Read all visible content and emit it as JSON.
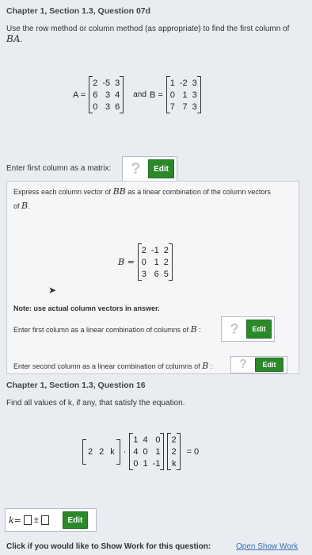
{
  "section1": {
    "title": "Chapter 1, Section 1.3, Question 07d",
    "instruction": "Use the row method or column method (as appropriate) to find the first column of",
    "target": "BA",
    "matrix_a_label": "A =",
    "matrix_a": [
      [
        "2",
        "-5",
        "3"
      ],
      [
        "6",
        "3",
        "4"
      ],
      [
        "0",
        "3",
        "6"
      ]
    ],
    "and_label": "and",
    "matrix_b_label": "B =",
    "matrix_b": [
      [
        "1",
        "-2",
        "3"
      ],
      [
        "0",
        "1",
        "3"
      ],
      [
        "7",
        "7",
        "3"
      ]
    ],
    "enter_label": "Enter first column as a matrix:",
    "placeholder": "?",
    "edit_label": "Edit"
  },
  "hint": {
    "text_a": "Express each column vector of",
    "var_a": "BB",
    "text_b": "as a linear combination of the column vectors",
    "text_c": "of",
    "var_b": "B",
    "matrix_label": "B =",
    "matrix": [
      [
        "2",
        "-1",
        "2"
      ],
      [
        "0",
        "1",
        "2"
      ],
      [
        "3",
        "6",
        "5"
      ]
    ],
    "note_bold": "Note:",
    "note_text": "use actual column vectors in answer.",
    "first_col_label": "Enter first column as a linear combination of columns of",
    "second_col_label": "Enter second column as a linear combination of columns of",
    "var_c": "B",
    "colon": ":",
    "placeholder": "?",
    "edit_label": "Edit"
  },
  "section2": {
    "title": "Chapter 1, Section 1.3, Question 16",
    "instruction": "Find all values of k, if any, that satisfy the equation.",
    "row_vec": [
      "2",
      "2",
      "k"
    ],
    "dot": "·",
    "matrix": [
      [
        "1",
        "4",
        "0"
      ],
      [
        "4",
        "0",
        "1"
      ],
      [
        "0",
        "1",
        "-1"
      ]
    ],
    "col_vec": [
      "2",
      "2",
      "k"
    ],
    "equals": "= 0",
    "k_label": "k=",
    "pm": "±",
    "edit_label": "Edit"
  },
  "footer": {
    "label": "Click if you would like to Show Work for this question:",
    "link": "Open Show Work"
  }
}
